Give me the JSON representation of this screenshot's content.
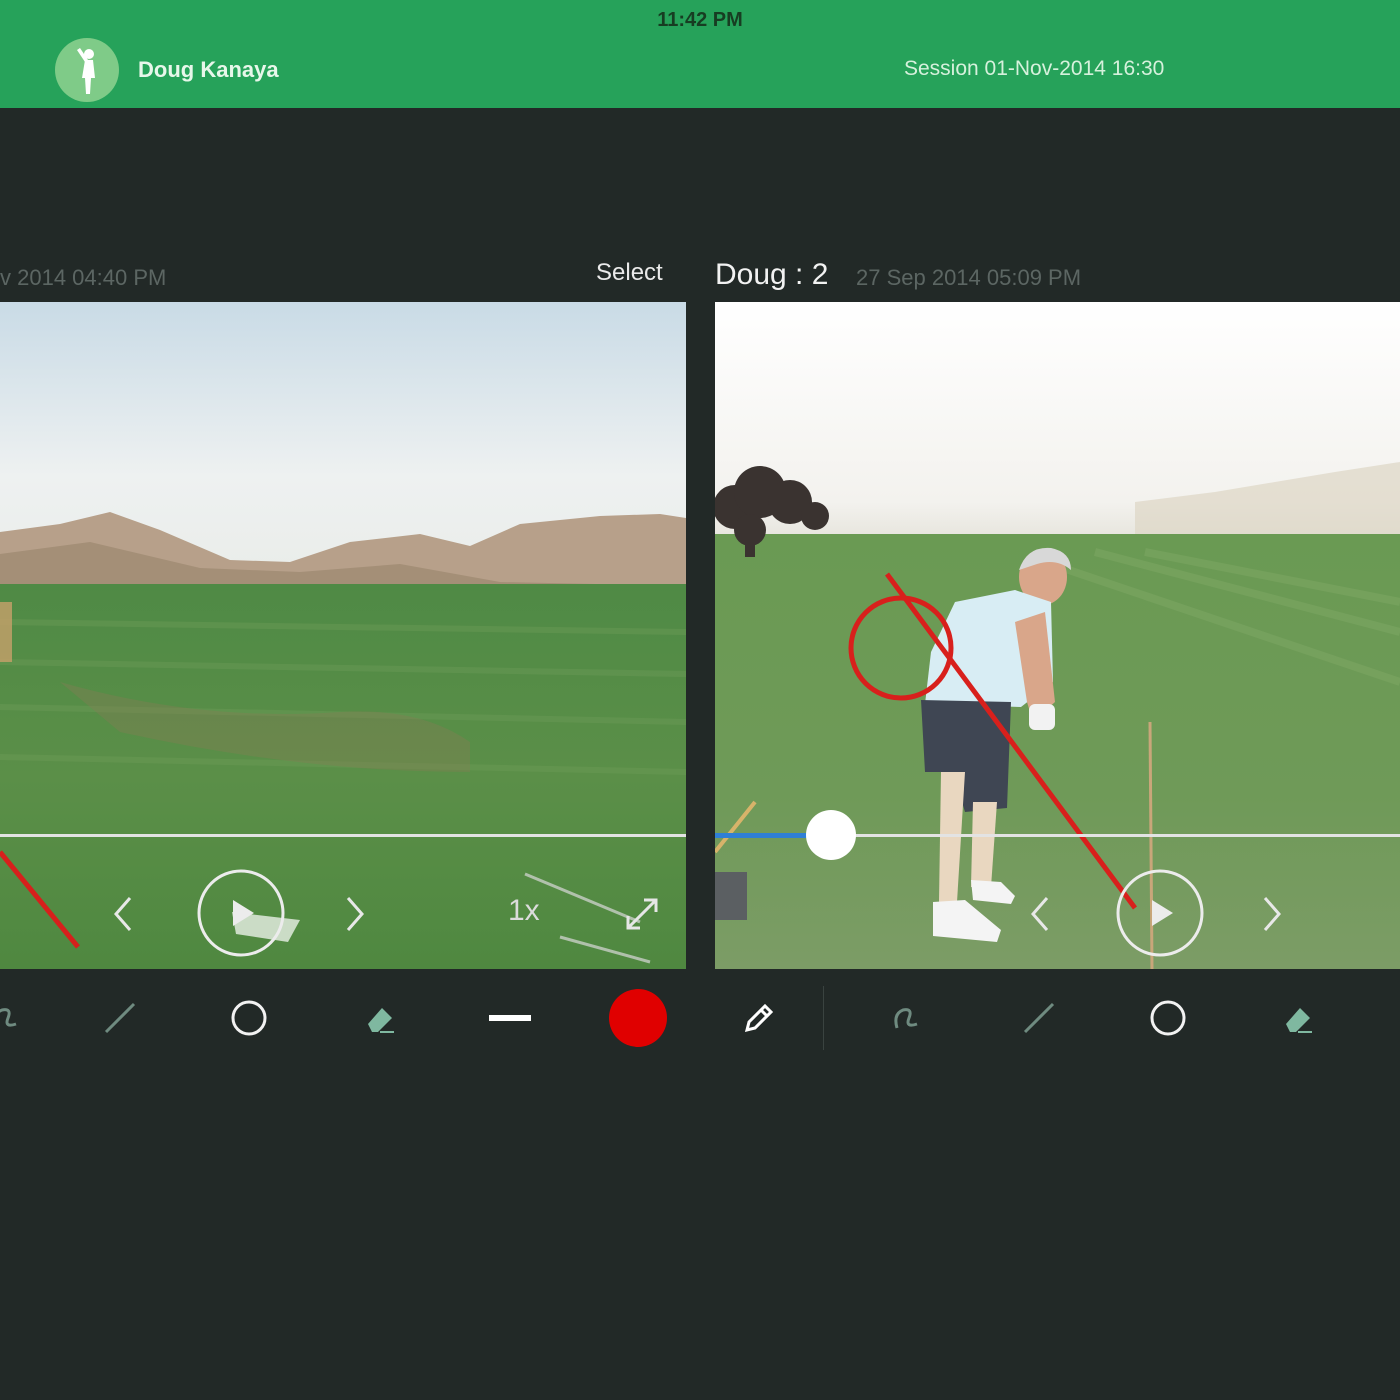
{
  "status_bar": {
    "time": "11:42 PM"
  },
  "header": {
    "user_name": "Doug Kanaya",
    "session_label": "Session 01-Nov-2014 16:30",
    "accent_color": "#26a25a"
  },
  "left_panel": {
    "date_fragment": "v 2014 04:40 PM",
    "select_label": "Select",
    "speed_label": "1x",
    "icons": [
      "prev-frame-icon",
      "play-icon",
      "next-frame-icon",
      "fullscreen-icon"
    ]
  },
  "right_panel": {
    "title": "Doug : 2",
    "date": "27 Sep 2014 05:09 PM",
    "progress_fraction": 0.17,
    "icons": [
      "prev-frame-icon",
      "play-icon",
      "next-frame-icon"
    ]
  },
  "left_toolbar": {
    "tools": [
      "freehand-icon",
      "line-icon",
      "circle-icon",
      "eraser-icon",
      "line-width-icon",
      "color-swatch"
    ],
    "active_color": "#e00000"
  },
  "right_toolbar": {
    "tools": [
      "pencil-icon",
      "freehand-icon",
      "line-icon",
      "circle-icon",
      "eraser-icon"
    ]
  }
}
